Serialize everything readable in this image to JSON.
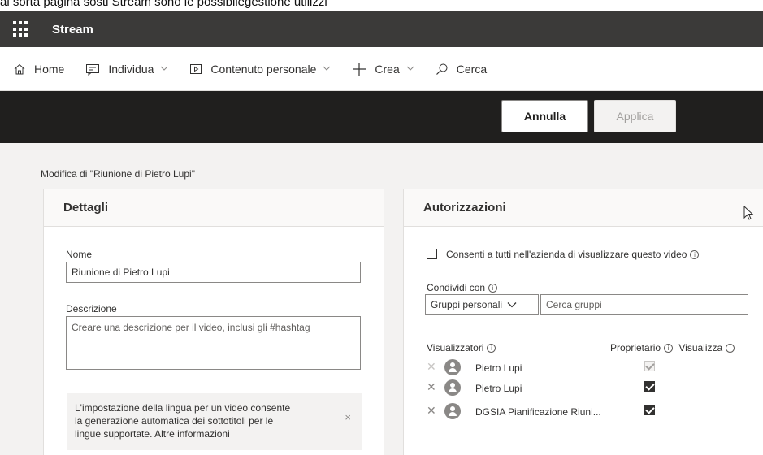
{
  "top_caption": "al sorta pagina sosti Stream sono le possibilegestione utilizzi",
  "app": {
    "title": "Stream"
  },
  "nav": {
    "home": "Home",
    "discover": "Individua",
    "my_content": "Contenuto personale",
    "create": "Crea",
    "search": "Cerca"
  },
  "commands": {
    "cancel": "Annulla",
    "apply": "Applica"
  },
  "edit_title": "Modifica di \"Riunione di Pietro Lupi\"",
  "details": {
    "header": "Dettagli",
    "name_label": "Nome",
    "name_value": "Riunione di Pietro Lupi",
    "description_label": "Descrizione",
    "description_placeholder": "Creare una descrizione per il video, inclusi gli #hashtag",
    "language_info_line1": "L'impostazione della lingua per un video consente",
    "language_info_line2": "la generazione automatica dei sottotitoli per le",
    "language_info_line3": "lingue supportate. Altre informazioni",
    "close_glyph": "×"
  },
  "permissions": {
    "header": "Autorizzazioni",
    "allow_all_label": "Consenti a tutti nell'azienda di visualizzare questo video",
    "allow_all_checked": false,
    "share_with_label": "Condividi con",
    "share_select": "Gruppi personali",
    "search_groups_placeholder": "Cerca gruppi",
    "viewers_label": "Visualizzatori",
    "owner_label": "Proprietario",
    "view_label": "Visualizza",
    "info_glyph": "i",
    "viewers": [
      {
        "name": "Pietro Lupi",
        "owner": true,
        "disabled": true
      },
      {
        "name": "Pietro Lupi",
        "owner": true,
        "disabled": false
      },
      {
        "name": "DGSIA Pianificazione Riuni...",
        "owner": true,
        "disabled": false
      }
    ]
  }
}
